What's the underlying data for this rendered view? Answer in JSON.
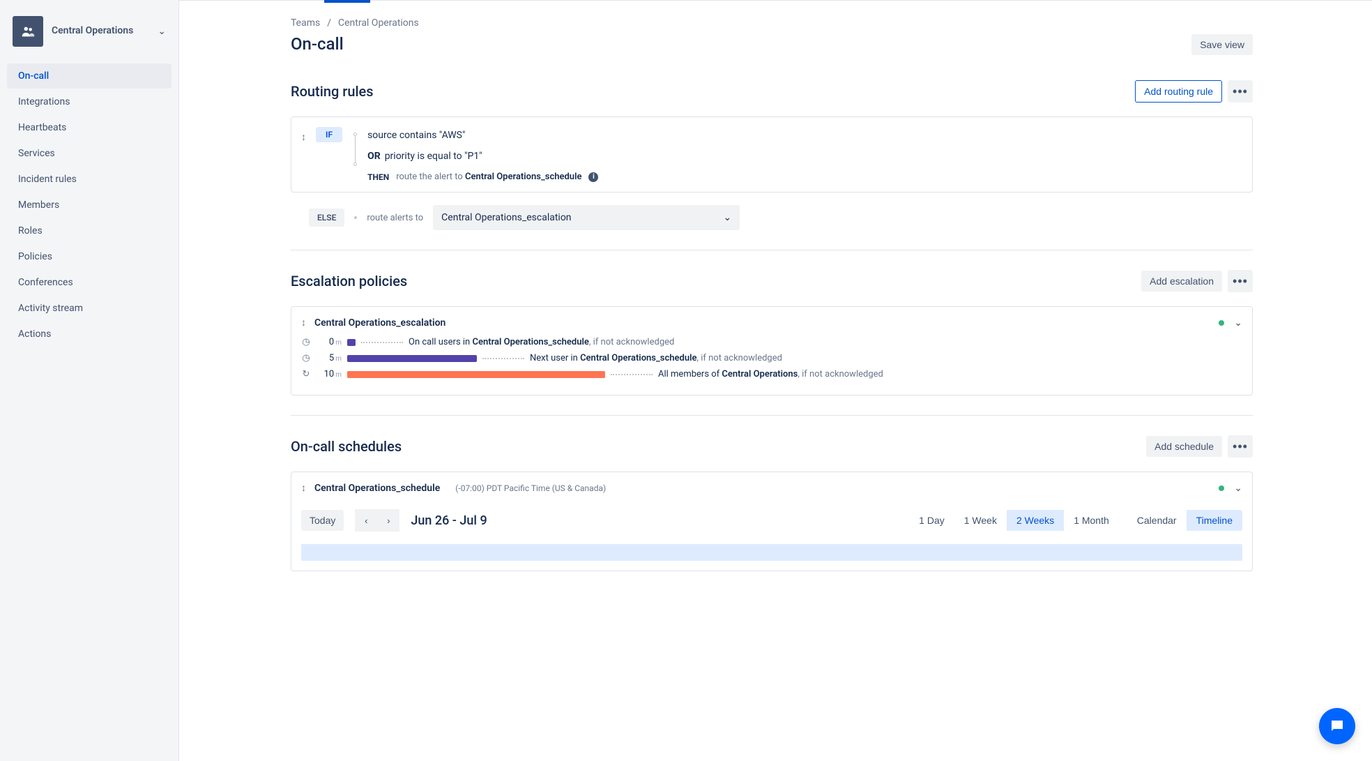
{
  "team": {
    "name": "Central Operations"
  },
  "sidebar": {
    "items": [
      {
        "label": "On-call",
        "active": true
      },
      {
        "label": "Integrations"
      },
      {
        "label": "Heartbeats"
      },
      {
        "label": "Services"
      },
      {
        "label": "Incident rules"
      },
      {
        "label": "Members"
      },
      {
        "label": "Roles"
      },
      {
        "label": "Policies"
      },
      {
        "label": "Conferences"
      },
      {
        "label": "Activity stream"
      },
      {
        "label": "Actions"
      }
    ]
  },
  "breadcrumb": {
    "root": "Teams",
    "current": "Central Operations"
  },
  "page": {
    "title": "On-call",
    "save_view": "Save view"
  },
  "routing": {
    "title": "Routing rules",
    "add_button": "Add routing rule",
    "if_label": "IF",
    "cond1": "source contains \"AWS\"",
    "or_label": "OR",
    "cond2": "priority is equal to \"P1\"",
    "then_label": "THEN",
    "then_prefix": "route the alert to ",
    "then_target": "Central Operations_schedule",
    "else_label": "ELSE",
    "else_text": "route alerts to",
    "else_select": "Central Operations_escalation"
  },
  "escalation": {
    "title": "Escalation policies",
    "add_button": "Add escalation",
    "policy_name": "Central Operations_escalation",
    "steps": [
      {
        "time": "0",
        "unit": "m",
        "prefix": "On call users in ",
        "bold": "Central Operations_schedule",
        "suffix": ", if not acknowledged"
      },
      {
        "time": "5",
        "unit": "m",
        "prefix": "Next user in ",
        "bold": "Central Operations_schedule",
        "suffix": ", if not acknowledged"
      },
      {
        "time": "10",
        "unit": "m",
        "prefix": "All members of ",
        "bold": "Central Operations",
        "suffix": ", if not acknowledged"
      }
    ]
  },
  "schedules": {
    "title": "On-call schedules",
    "add_button": "Add schedule",
    "schedule_name": "Central Operations_schedule",
    "tz": "(-07:00) PDT Pacific Time (US & Canada)",
    "today": "Today",
    "date_range": "Jun 26 - Jul 9",
    "ranges": [
      "1 Day",
      "1 Week",
      "2 Weeks",
      "1 Month"
    ],
    "active_range": "2 Weeks",
    "views": [
      "Calendar",
      "Timeline"
    ],
    "active_view": "Timeline"
  }
}
